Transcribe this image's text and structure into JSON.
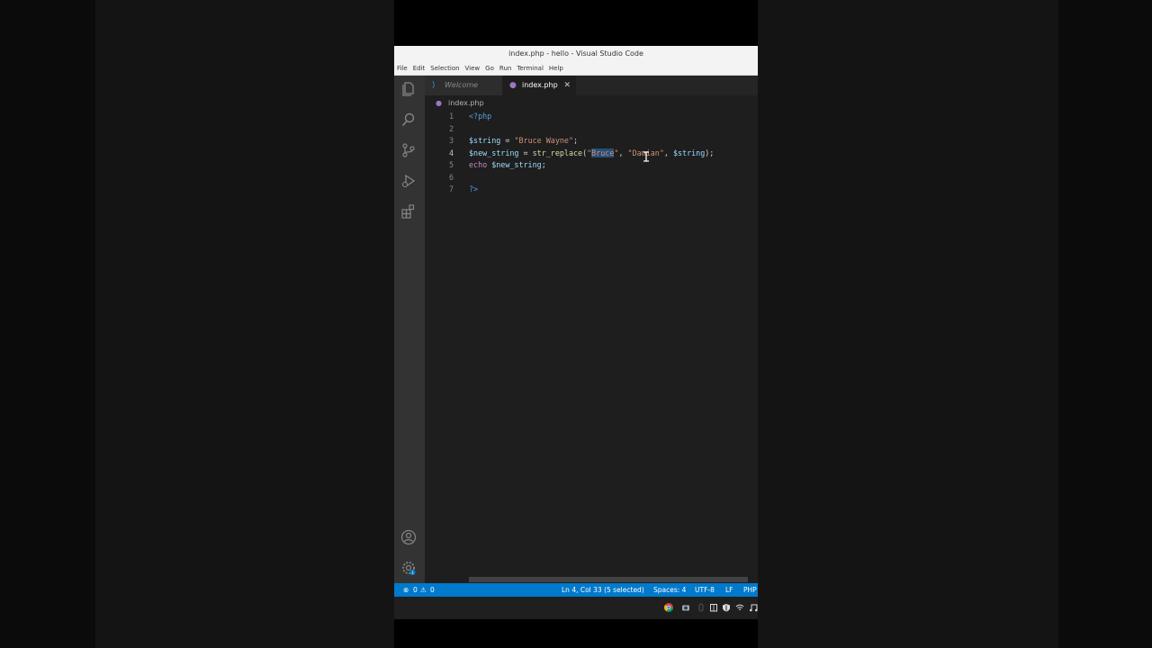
{
  "window": {
    "title": "index.php - hello - Visual Studio Code"
  },
  "menu": [
    "File",
    "Edit",
    "Selection",
    "View",
    "Go",
    "Run",
    "Terminal",
    "Help"
  ],
  "tabs": [
    {
      "label": "Welcome",
      "icon": "vscode-logo-icon"
    },
    {
      "label": "index.php",
      "icon": "php-file-icon",
      "close": "✕"
    }
  ],
  "breadcrumb": {
    "file": "index.php"
  },
  "editor": {
    "line_numbers": [
      "1",
      "2",
      "3",
      "4",
      "5",
      "6",
      "7"
    ],
    "lines": {
      "l1": {
        "open": "<?php"
      },
      "l3": {
        "var": "$string",
        "eq": " = ",
        "str": "\"Bruce Wayne\"",
        "semi": ";"
      },
      "l4": {
        "var": "$new_string",
        "eq": " = ",
        "fn": "str_replace",
        "lp": "(",
        "q1": "\"",
        "sel": "Bruce",
        "q2": "\"",
        "c1": ", ",
        "str2": "\"Damian\"",
        "c2": ", ",
        "var2": "$string",
        "rp": ");"
      },
      "l5": {
        "kw": "echo",
        "var": " $new_string",
        "semi": ";"
      },
      "l7": {
        "close": "?>"
      }
    }
  },
  "status": {
    "errors": "0",
    "warnings": "0",
    "position": "Ln 4, Col 33 (5 selected)",
    "spaces": "Spaces: 4",
    "encoding": "UTF-8",
    "eol": "LF",
    "language": "PHP"
  },
  "activity": {
    "accounts_badge": "1"
  },
  "colors": {
    "statusbar": "#007acc",
    "activitybar": "#333333",
    "editor_bg": "#1e1e1e"
  }
}
